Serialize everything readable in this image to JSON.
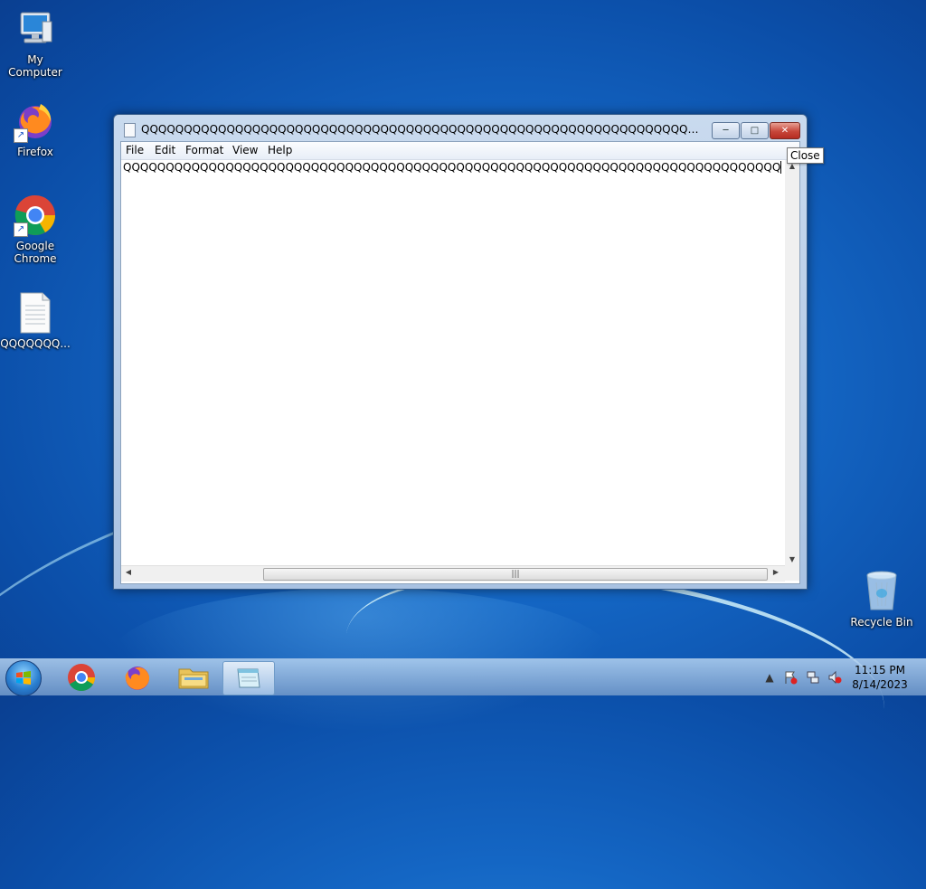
{
  "desktop": {
    "icons": [
      {
        "label": "My Computer",
        "icon": "computer-icon"
      },
      {
        "label": "Firefox",
        "icon": "firefox-icon"
      },
      {
        "label": "Google Chrome",
        "icon": "chrome-icon"
      },
      {
        "label": "QQQQQQQ...",
        "icon": "text-file-icon"
      },
      {
        "label": "Recycle Bin",
        "icon": "recycle-bin-icon"
      }
    ]
  },
  "notepad": {
    "title": "QQQQQQQQQQQQQQQQQQQQQQQQQQQQQQQQQQQQQQQQQQQQQQQQQQQQQQQQQQQQQQQQQQQQQQQQQQQQQQQQ...",
    "menu": [
      "File",
      "Edit",
      "Format",
      "View",
      "Help"
    ],
    "content": "QQQQQQQQQQQQQQQQQQQQQQQQQQQQQQQQQQQQQQQQQQQQQQQQQQQQQQQQQQQQQQQQQQQQQQQQQQQQQQQQQQQQQQQQQQQQQQQQQQQQ",
    "buttons": {
      "minimize": "minimize",
      "maximize": "maximize",
      "close": "close"
    }
  },
  "tooltip": {
    "text": "Close"
  },
  "taskbar": {
    "pinned": [
      "start-orb",
      "chrome-icon",
      "firefox-icon",
      "file-explorer-icon",
      "notepad-icon"
    ],
    "active_app": "notepad-icon",
    "tray_icons": [
      "show-hidden-icons-icon",
      "action-center-flag-icon",
      "network-icon",
      "volume-muted-icon"
    ],
    "clock": {
      "time": "11:15 PM",
      "date": "8/14/2023"
    }
  }
}
